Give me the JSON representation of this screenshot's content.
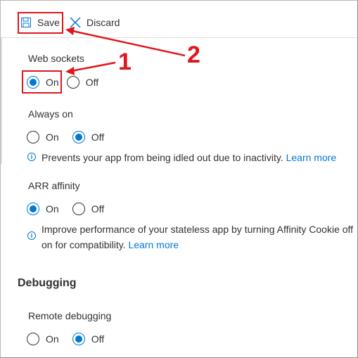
{
  "toolbar": {
    "save_label": "Save",
    "discard_label": "Discard"
  },
  "web_sockets": {
    "label": "Web sockets",
    "on_label": "On",
    "off_label": "Off",
    "selected": "On"
  },
  "always_on": {
    "label": "Always on",
    "on_label": "On",
    "off_label": "Off",
    "selected": "Off",
    "info_text": "Prevents your app from being idled out due to inactivity.",
    "info_link": "Learn more"
  },
  "arr_affinity": {
    "label": "ARR affinity",
    "on_label": "On",
    "off_label": "Off",
    "selected": "On",
    "info_text_line1": "Improve performance of your stateless app by turning Affinity Cookie off",
    "info_text_line2": "on for compatibility.",
    "info_link": "Learn more"
  },
  "debugging": {
    "heading": "Debugging",
    "remote_label": "Remote debugging",
    "on_label": "On",
    "off_label": "Off",
    "selected": "Off"
  },
  "annotations": {
    "num1": "1",
    "num2": "2",
    "color": "#e0161b"
  },
  "colors": {
    "accent": "#0078d4",
    "text": "#323130",
    "annotation": "#e0161b"
  },
  "icons": {
    "save": "floppy-disk-icon",
    "discard": "close-x-icon",
    "info": "info-circle-icon"
  }
}
